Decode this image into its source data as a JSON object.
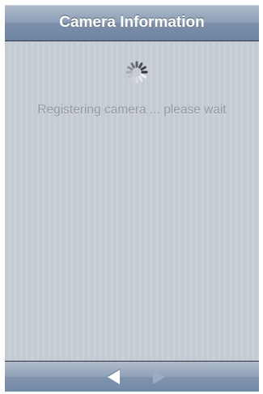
{
  "navbar": {
    "title": "Camera Information"
  },
  "main": {
    "status_text": "Registering camera ... please wait"
  },
  "spinner": {
    "icon": "activity-indicator-icon"
  },
  "toolbar": {
    "back": {
      "icon": "back-arrow-icon",
      "enabled": true
    },
    "forward": {
      "icon": "forward-arrow-icon",
      "enabled": false
    }
  },
  "colors": {
    "navbar": "#7b8fab",
    "background": "#c5ccd4",
    "status_text": "#949ba5"
  }
}
